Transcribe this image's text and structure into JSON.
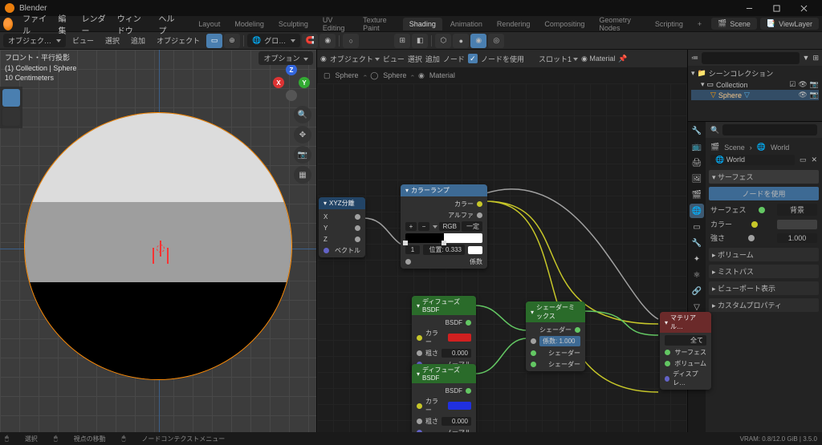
{
  "app": {
    "title": "Blender"
  },
  "window_controls": {
    "minimize": "–",
    "maximize": "□",
    "close": "×"
  },
  "menus": [
    "ファイル",
    "編集",
    "レンダー",
    "ウィンドウ",
    "ヘルプ"
  ],
  "workspaces": {
    "items": [
      "Layout",
      "Modeling",
      "Sculpting",
      "UV Editing",
      "Texture Paint",
      "Shading",
      "Animation",
      "Rendering",
      "Compositing",
      "Geometry Nodes",
      "Scripting"
    ],
    "active": "Shading",
    "add": "+"
  },
  "scene_selector": {
    "icon": "scene",
    "label": "Scene"
  },
  "viewlayer_selector": {
    "label": "ViewLayer"
  },
  "viewport_header": {
    "mode_dropdown": "オブジェク…",
    "menus": [
      "ビュー",
      "選択",
      "追加",
      "オブジェクト"
    ],
    "global_dropdown": "グロ…",
    "options_btn": "オプション"
  },
  "viewport_overlay": {
    "line1": "フロント・平行投影",
    "line2": "(1) Collection | Sphere",
    "line3": "10 Centimeters"
  },
  "gizmo": {
    "x": "X",
    "y": "Y",
    "z": "Z"
  },
  "node_header": {
    "menus": [
      "ビュー",
      "選択",
      "追加",
      "ノード"
    ],
    "use_nodes_check": true,
    "use_nodes_label": "ノードを使用",
    "slot_dropdown": "スロット1",
    "material_dropdown": "Material",
    "object_dropdown": "オブジェクト"
  },
  "node_breadcrumb": {
    "obj": "Sphere",
    "data": "Sphere",
    "mat": "Material"
  },
  "nodes": {
    "sep_xyz": {
      "title": "XYZ分離",
      "out": [
        "X",
        "Y",
        "Z"
      ],
      "in": "ベクトル"
    },
    "color_ramp": {
      "title": "カラーランプ",
      "out_color": "カラー",
      "out_alpha": "アルファ",
      "mode": "RGB",
      "interp": "一定",
      "pos_label": "位置:",
      "pos_value": "0.333",
      "in_fac": "係数",
      "selected_index": "1"
    },
    "diffuse1": {
      "title": "ディフューズBSDF",
      "out": "BSDF",
      "color_label": "カラー",
      "rough_label": "粗さ",
      "rough_value": "0.000",
      "normal_label": "ノーマル",
      "color": "#d02020"
    },
    "diffuse2": {
      "title": "ディフューズBSDF",
      "out": "BSDF",
      "color_label": "カラー",
      "rough_label": "粗さ",
      "rough_value": "0.000",
      "normal_label": "ノーマル",
      "color": "#2030e0"
    },
    "mix": {
      "title": "シェーダーミックス",
      "out": "シェーダー",
      "fac_label": "係数:",
      "fac_value": "1.000",
      "in1": "シェーダー",
      "in2": "シェーダー"
    },
    "output": {
      "title": "マテリアル…",
      "tgt": "全て",
      "surface": "サーフェス",
      "volume": "ボリューム",
      "disp": "ディスプレ…"
    }
  },
  "outliner": {
    "title": "シーンコレクション",
    "collection": "Collection",
    "object": "Sphere"
  },
  "properties": {
    "search_placeholder": "",
    "scene_crumb": "Scene",
    "world_crumb": "World",
    "world_dropdown": "World",
    "surface_panel": "サーフェス",
    "use_nodes_btn": "ノードを使用",
    "surface_label": "サーフェス",
    "surface_value": "背景",
    "color_label": "カラー",
    "strength_label": "強さ",
    "strength_value": "1.000",
    "sections": [
      "ボリューム",
      "ミストパス",
      "ビューポート表示",
      "カスタムプロパティ"
    ]
  },
  "statusbar": {
    "select": "選択",
    "move": "視点の移動",
    "context": "ノードコンテクストメニュー",
    "vram": "VRAM: 0.8/12.0 GiB | 3.5.0"
  }
}
